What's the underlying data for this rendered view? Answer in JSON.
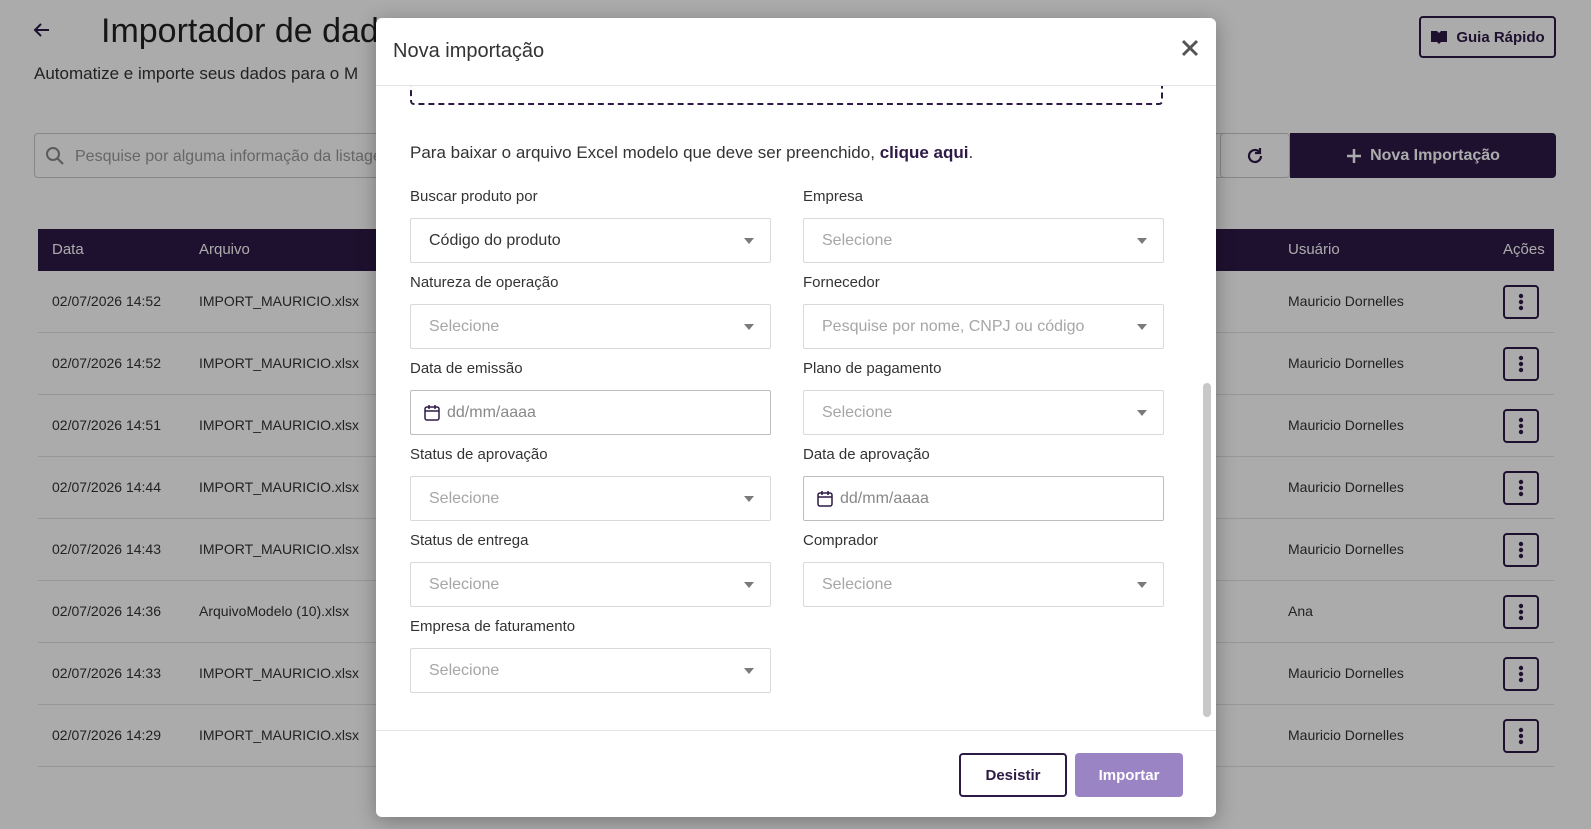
{
  "page": {
    "title": "Importador de dados",
    "subtitle": "Automatize e importe seus dados para o M",
    "guide_label": "Guia Rápido",
    "search_placeholder": "Pesquise por alguma informação da listagem",
    "new_import_label": "Nova Importação"
  },
  "table": {
    "headers": {
      "date": "Data",
      "file": "Arquivo",
      "user": "Usuário",
      "actions": "Ações"
    },
    "rows": [
      {
        "date": "02/07/2026 14:52",
        "file": "IMPORT_MAURICIO.xlsx",
        "user": "Mauricio Dornelles"
      },
      {
        "date": "02/07/2026 14:52",
        "file": "IMPORT_MAURICIO.xlsx",
        "user": "Mauricio Dornelles"
      },
      {
        "date": "02/07/2026 14:51",
        "file": "IMPORT_MAURICIO.xlsx",
        "user": "Mauricio Dornelles"
      },
      {
        "date": "02/07/2026 14:44",
        "file": "IMPORT_MAURICIO.xlsx",
        "user": "Mauricio Dornelles"
      },
      {
        "date": "02/07/2026 14:43",
        "file": "IMPORT_MAURICIO.xlsx",
        "user": "Mauricio Dornelles"
      },
      {
        "date": "02/07/2026 14:36",
        "file": "ArquivoModelo (10).xlsx",
        "user": "Ana"
      },
      {
        "date": "02/07/2026 14:33",
        "file": "IMPORT_MAURICIO.xlsx",
        "user": "Mauricio Dornelles"
      },
      {
        "date": "02/07/2026 14:29",
        "file": "IMPORT_MAURICIO.xlsx",
        "user": "Mauricio Dornelles"
      }
    ]
  },
  "modal": {
    "title": "Nova importação",
    "download_text": "Para baixar o arquivo Excel modelo que deve ser preenchido,",
    "download_link": "clique aqui",
    "download_end": ".",
    "fields": {
      "buscar_produto": {
        "label": "Buscar produto por",
        "value": "Código do produto"
      },
      "empresa": {
        "label": "Empresa",
        "placeholder": "Selecione"
      },
      "natureza": {
        "label": "Natureza de operação",
        "placeholder": "Selecione"
      },
      "fornecedor": {
        "label": "Fornecedor",
        "placeholder": "Pesquise por nome, CNPJ ou código"
      },
      "data_emissao": {
        "label": "Data de emissão",
        "placeholder": "dd/mm/aaaa"
      },
      "plano_pagamento": {
        "label": "Plano de pagamento",
        "placeholder": "Selecione"
      },
      "status_aprovacao": {
        "label": "Status de aprovação",
        "placeholder": "Selecione"
      },
      "data_aprovacao": {
        "label": "Data de aprovação",
        "placeholder": "dd/mm/aaaa"
      },
      "status_entrega": {
        "label": "Status de entrega",
        "placeholder": "Selecione"
      },
      "comprador": {
        "label": "Comprador",
        "placeholder": "Selecione"
      },
      "empresa_faturamento": {
        "label": "Empresa de faturamento",
        "placeholder": "Selecione"
      }
    },
    "cancel_label": "Desistir",
    "import_label": "Importar"
  },
  "colors": {
    "brand": "#2e1a47",
    "import_button": "#9a84c4"
  }
}
